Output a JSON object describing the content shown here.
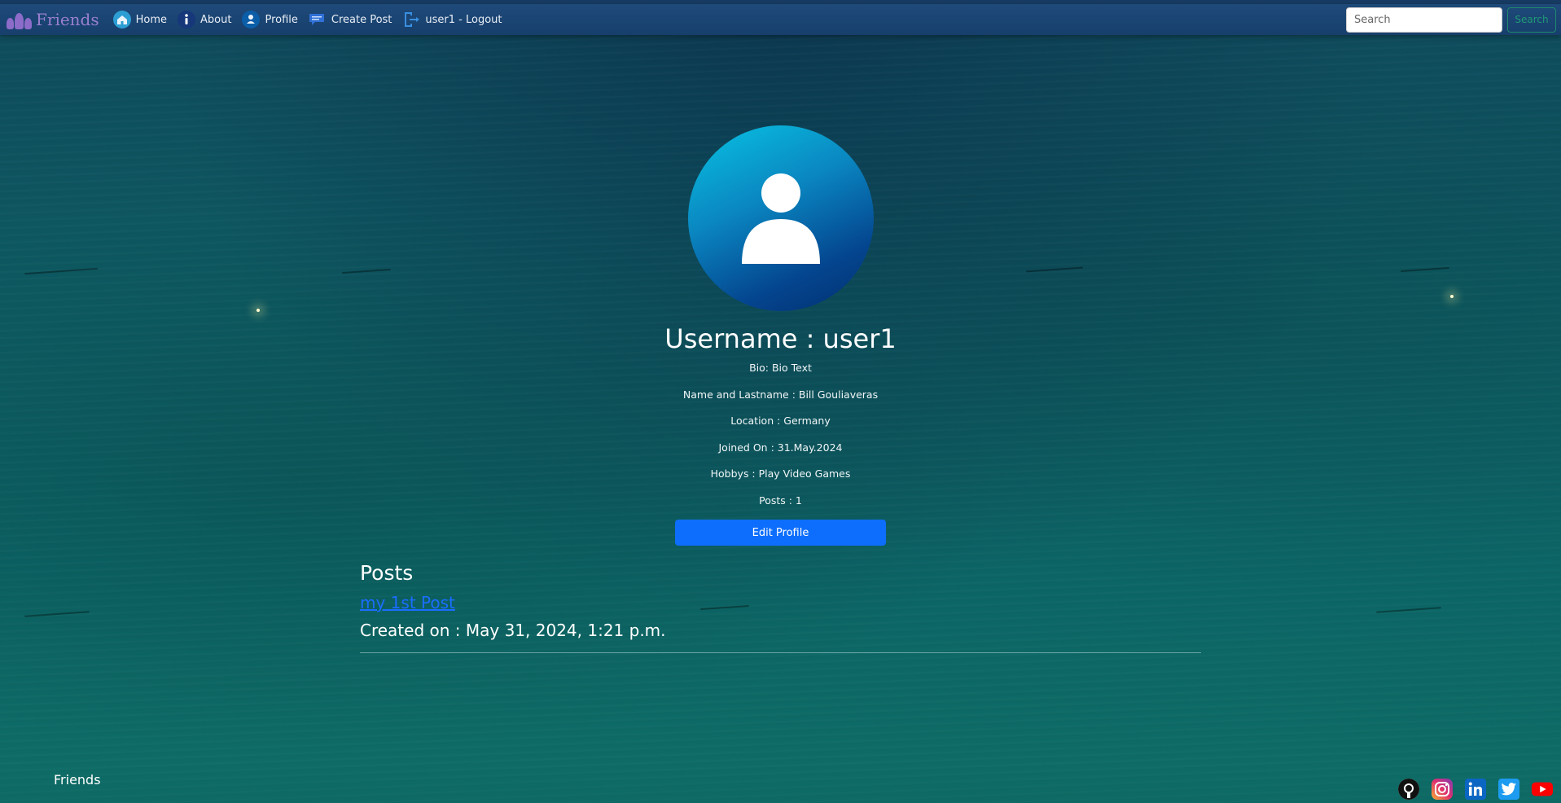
{
  "nav": {
    "brand": "Friends",
    "items": [
      {
        "label": "Home",
        "icon": "home-icon"
      },
      {
        "label": "About",
        "icon": "info-icon"
      },
      {
        "label": "Profile",
        "icon": "user-icon"
      },
      {
        "label": "Create Post",
        "icon": "chat-icon"
      },
      {
        "label": "user1 - Logout",
        "icon": "logout-icon"
      }
    ],
    "search_placeholder": "Search",
    "search_button": "Search"
  },
  "profile": {
    "username": "Username : user1",
    "bio": "Bio: Bio Text",
    "name": "Name and Lastname : Bill Gouliaveras",
    "location": "Location : Germany",
    "joined": "Joined On : 31.May.2024",
    "hobbys": "Hobbys : Play Video Games",
    "posts_count": "Posts : 1",
    "edit_button": "Edit Profile"
  },
  "posts": {
    "heading": "Posts",
    "items": [
      {
        "title": "my 1st Post",
        "created": "Created on : May 31, 2024, 1:21 p.m."
      }
    ]
  },
  "footer": {
    "brand": "Friends",
    "socials": [
      "github-icon",
      "instagram-icon",
      "linkedin-icon",
      "twitter-icon",
      "youtube-icon"
    ]
  },
  "colors": {
    "accent": "#0d6efd",
    "link": "#1a6dff",
    "navbar": "#1e4a7a"
  }
}
